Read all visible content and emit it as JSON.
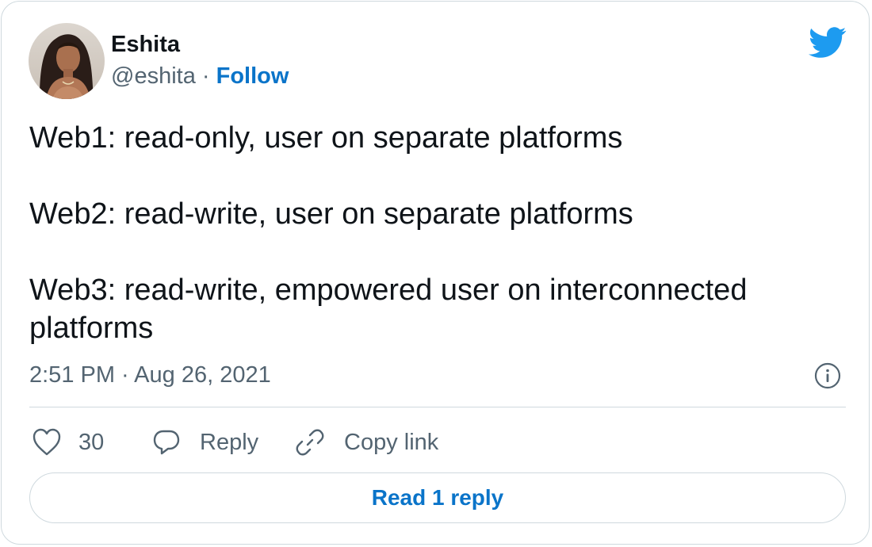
{
  "author": {
    "name": "Eshita",
    "handle": "@eshita",
    "separator": "·",
    "follow_label": "Follow"
  },
  "tweet": {
    "paragraphs": [
      "Web1: read-only, user on separate platforms",
      "Web2: read-write, user on separate platforms",
      "Web3: read-write, empowered user on interconnected platforms"
    ],
    "timestamp": "2:51 PM · Aug 26, 2021"
  },
  "actions": {
    "like_count": "30",
    "reply_label": "Reply",
    "copy_link_label": "Copy link"
  },
  "read_replies_label": "Read 1 reply",
  "icons": {
    "brand": "twitter-bird-icon",
    "info": "info-icon",
    "like": "heart-icon",
    "reply": "speech-bubble-icon",
    "copy": "link-icon"
  },
  "colors": {
    "accent": "#0a74c9",
    "twitter_blue": "#1d9bf0",
    "text_primary": "#0f1419",
    "text_secondary": "#536471",
    "border": "#cfd9de"
  }
}
